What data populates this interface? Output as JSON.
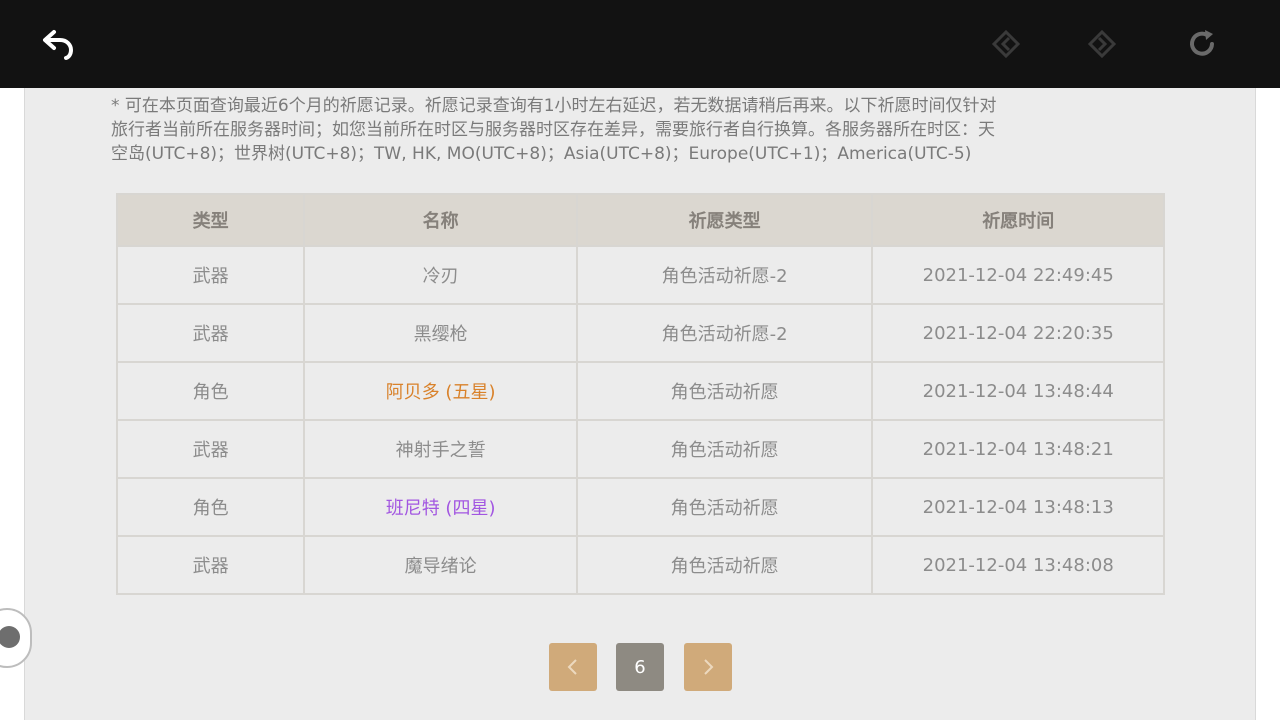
{
  "toolbar": {
    "back_icon": "back-arrow-icon",
    "prev_icon": "prev-page-icon",
    "next_icon": "next-page-icon",
    "reload_icon": "reload-icon"
  },
  "notice": {
    "line1": "* 可在本页面查询最近6个月的祈愿记录。祈愿记录查询有1小时左右延迟，若无数据请稍后再来。以下祈愿时间仅针对",
    "line2": "旅行者当前所在服务器时间；如您当前所在时区与服务器时区存在差异，需要旅行者自行换算。各服务器所在时区：天",
    "line3": "空岛(UTC+8)；世界树(UTC+8)；TW, HK, MO(UTC+8)；Asia(UTC+8)；Europe(UTC+1)；America(UTC-5)"
  },
  "table": {
    "headers": [
      "类型",
      "名称",
      "祈愿类型",
      "祈愿时间"
    ],
    "rows": [
      [
        "武器",
        "冷刃",
        "角色活动祈愿-2",
        "2021-12-04 22:49:45"
      ],
      [
        "武器",
        "黑缨枪",
        "角色活动祈愿-2",
        "2021-12-04 22:20:35"
      ],
      [
        "角色",
        "阿贝多 (五星)",
        "角色活动祈愿",
        "2021-12-04 13:48:44"
      ],
      [
        "武器",
        "神射手之誓",
        "角色活动祈愿",
        "2021-12-04 13:48:21"
      ],
      [
        "角色",
        "班尼特 (四星)",
        "角色活动祈愿",
        "2021-12-04 13:48:13"
      ],
      [
        "武器",
        "魔导绪论",
        "角色活动祈愿",
        "2021-12-04 13:48:08"
      ]
    ]
  },
  "colors": {
    "five_star": "#d9822b",
    "four_star": "#a256e1"
  },
  "pagination": {
    "current_page": "6",
    "prev_icon": "chevron-left-icon",
    "next_icon": "chevron-right-icon"
  }
}
